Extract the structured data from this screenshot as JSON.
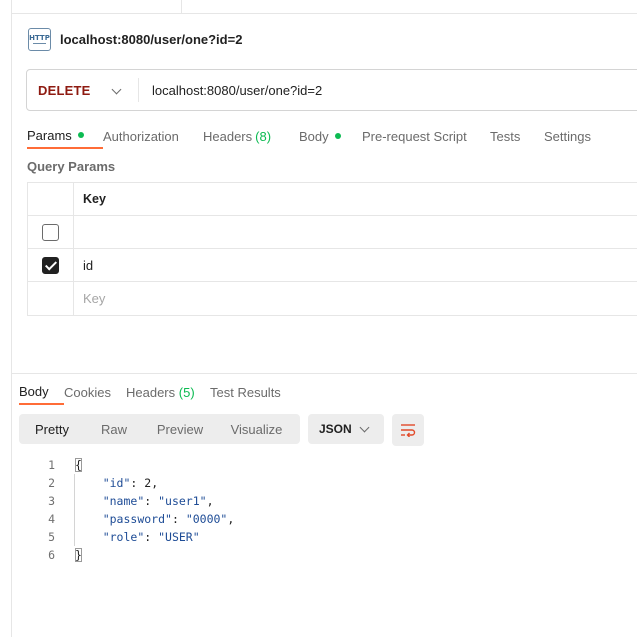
{
  "request": {
    "title": "localhost:8080/user/one?id=2",
    "icon": "http-icon",
    "icon_text": "HTTP",
    "method": "DELETE",
    "url": "localhost:8080/user/one?id=2"
  },
  "request_tabs": [
    {
      "label": "Params",
      "active": true,
      "dot": true
    },
    {
      "label": "Authorization"
    },
    {
      "label": "Headers",
      "count": "(8)"
    },
    {
      "label": "Body",
      "dot": true
    },
    {
      "label": "Pre-request Script"
    },
    {
      "label": "Tests"
    },
    {
      "label": "Settings"
    }
  ],
  "query_params": {
    "section_label": "Query Params",
    "header_key": "Key",
    "rows": [
      {
        "checked": false,
        "key": ""
      },
      {
        "checked": true,
        "key": "id"
      }
    ],
    "new_row_placeholder": "Key"
  },
  "response": {
    "tabs": [
      {
        "label": "Body",
        "active": true
      },
      {
        "label": "Cookies"
      },
      {
        "label": "Headers",
        "count": "(5)"
      },
      {
        "label": "Test Results"
      }
    ],
    "view_modes": [
      "Pretty",
      "Raw",
      "Preview",
      "Visualize"
    ],
    "active_view": "Pretty",
    "format": "JSON",
    "body_lines": [
      {
        "n": "1",
        "text": "{"
      },
      {
        "n": "2",
        "key": "\"id\"",
        "value": "2",
        "type": "number",
        "trail": ","
      },
      {
        "n": "3",
        "key": "\"name\"",
        "value": "\"user1\"",
        "type": "string",
        "trail": ","
      },
      {
        "n": "4",
        "key": "\"password\"",
        "value": "\"0000\"",
        "type": "string",
        "trail": ","
      },
      {
        "n": "5",
        "key": "\"role\"",
        "value": "\"USER\"",
        "type": "string",
        "trail": ""
      },
      {
        "n": "6",
        "text": "}"
      }
    ]
  },
  "colors": {
    "method": "#8e1a10",
    "accent": "#ff6c37",
    "dot": "#0cbb52",
    "wrap_icon": "#e24a2a"
  }
}
